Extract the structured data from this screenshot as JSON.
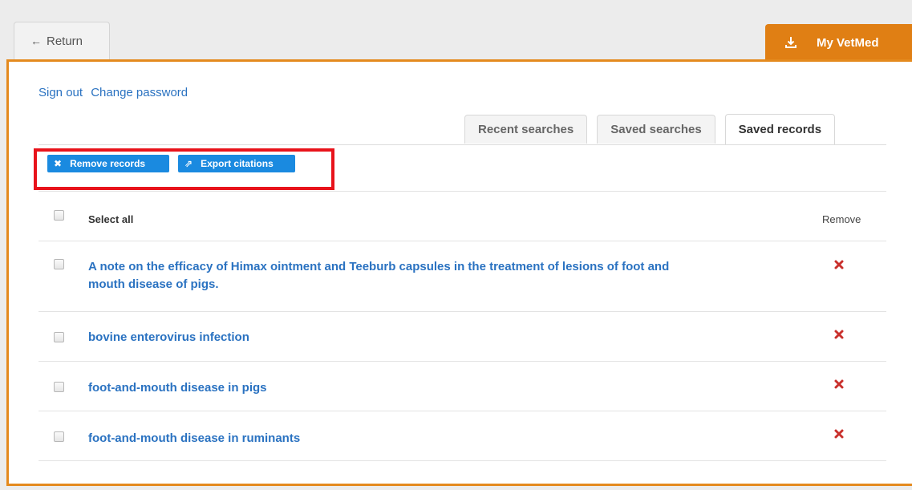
{
  "return_tab": {
    "label": "Return"
  },
  "myvetmed_tab": {
    "label": "My VetMed"
  },
  "auth": {
    "sign_out": "Sign out",
    "change_password": "Change password"
  },
  "tabs": [
    {
      "label": "Recent searches"
    },
    {
      "label": "Saved searches"
    },
    {
      "label": "Saved records"
    }
  ],
  "actions": {
    "remove_records": "Remove records",
    "export_citations": "Export citations"
  },
  "table": {
    "select_all": "Select all",
    "remove_header": "Remove",
    "records": [
      {
        "title_line1": "A note on the efficacy of Himax ointment and Teeburb capsules in the treatment of lesions of foot and",
        "title_line2": "mouth disease of pigs."
      },
      {
        "title_line1": "bovine enterovirus infection"
      },
      {
        "title_line1": "foot-and-mouth disease in pigs"
      },
      {
        "title_line1": "foot-and-mouth disease in ruminants"
      }
    ]
  },
  "colors": {
    "accent_orange": "#e07f14",
    "link_blue": "#2a72c1",
    "button_blue": "#1a8ae0",
    "remove_red": "#c9302c",
    "highlight_red": "#e8131b"
  }
}
